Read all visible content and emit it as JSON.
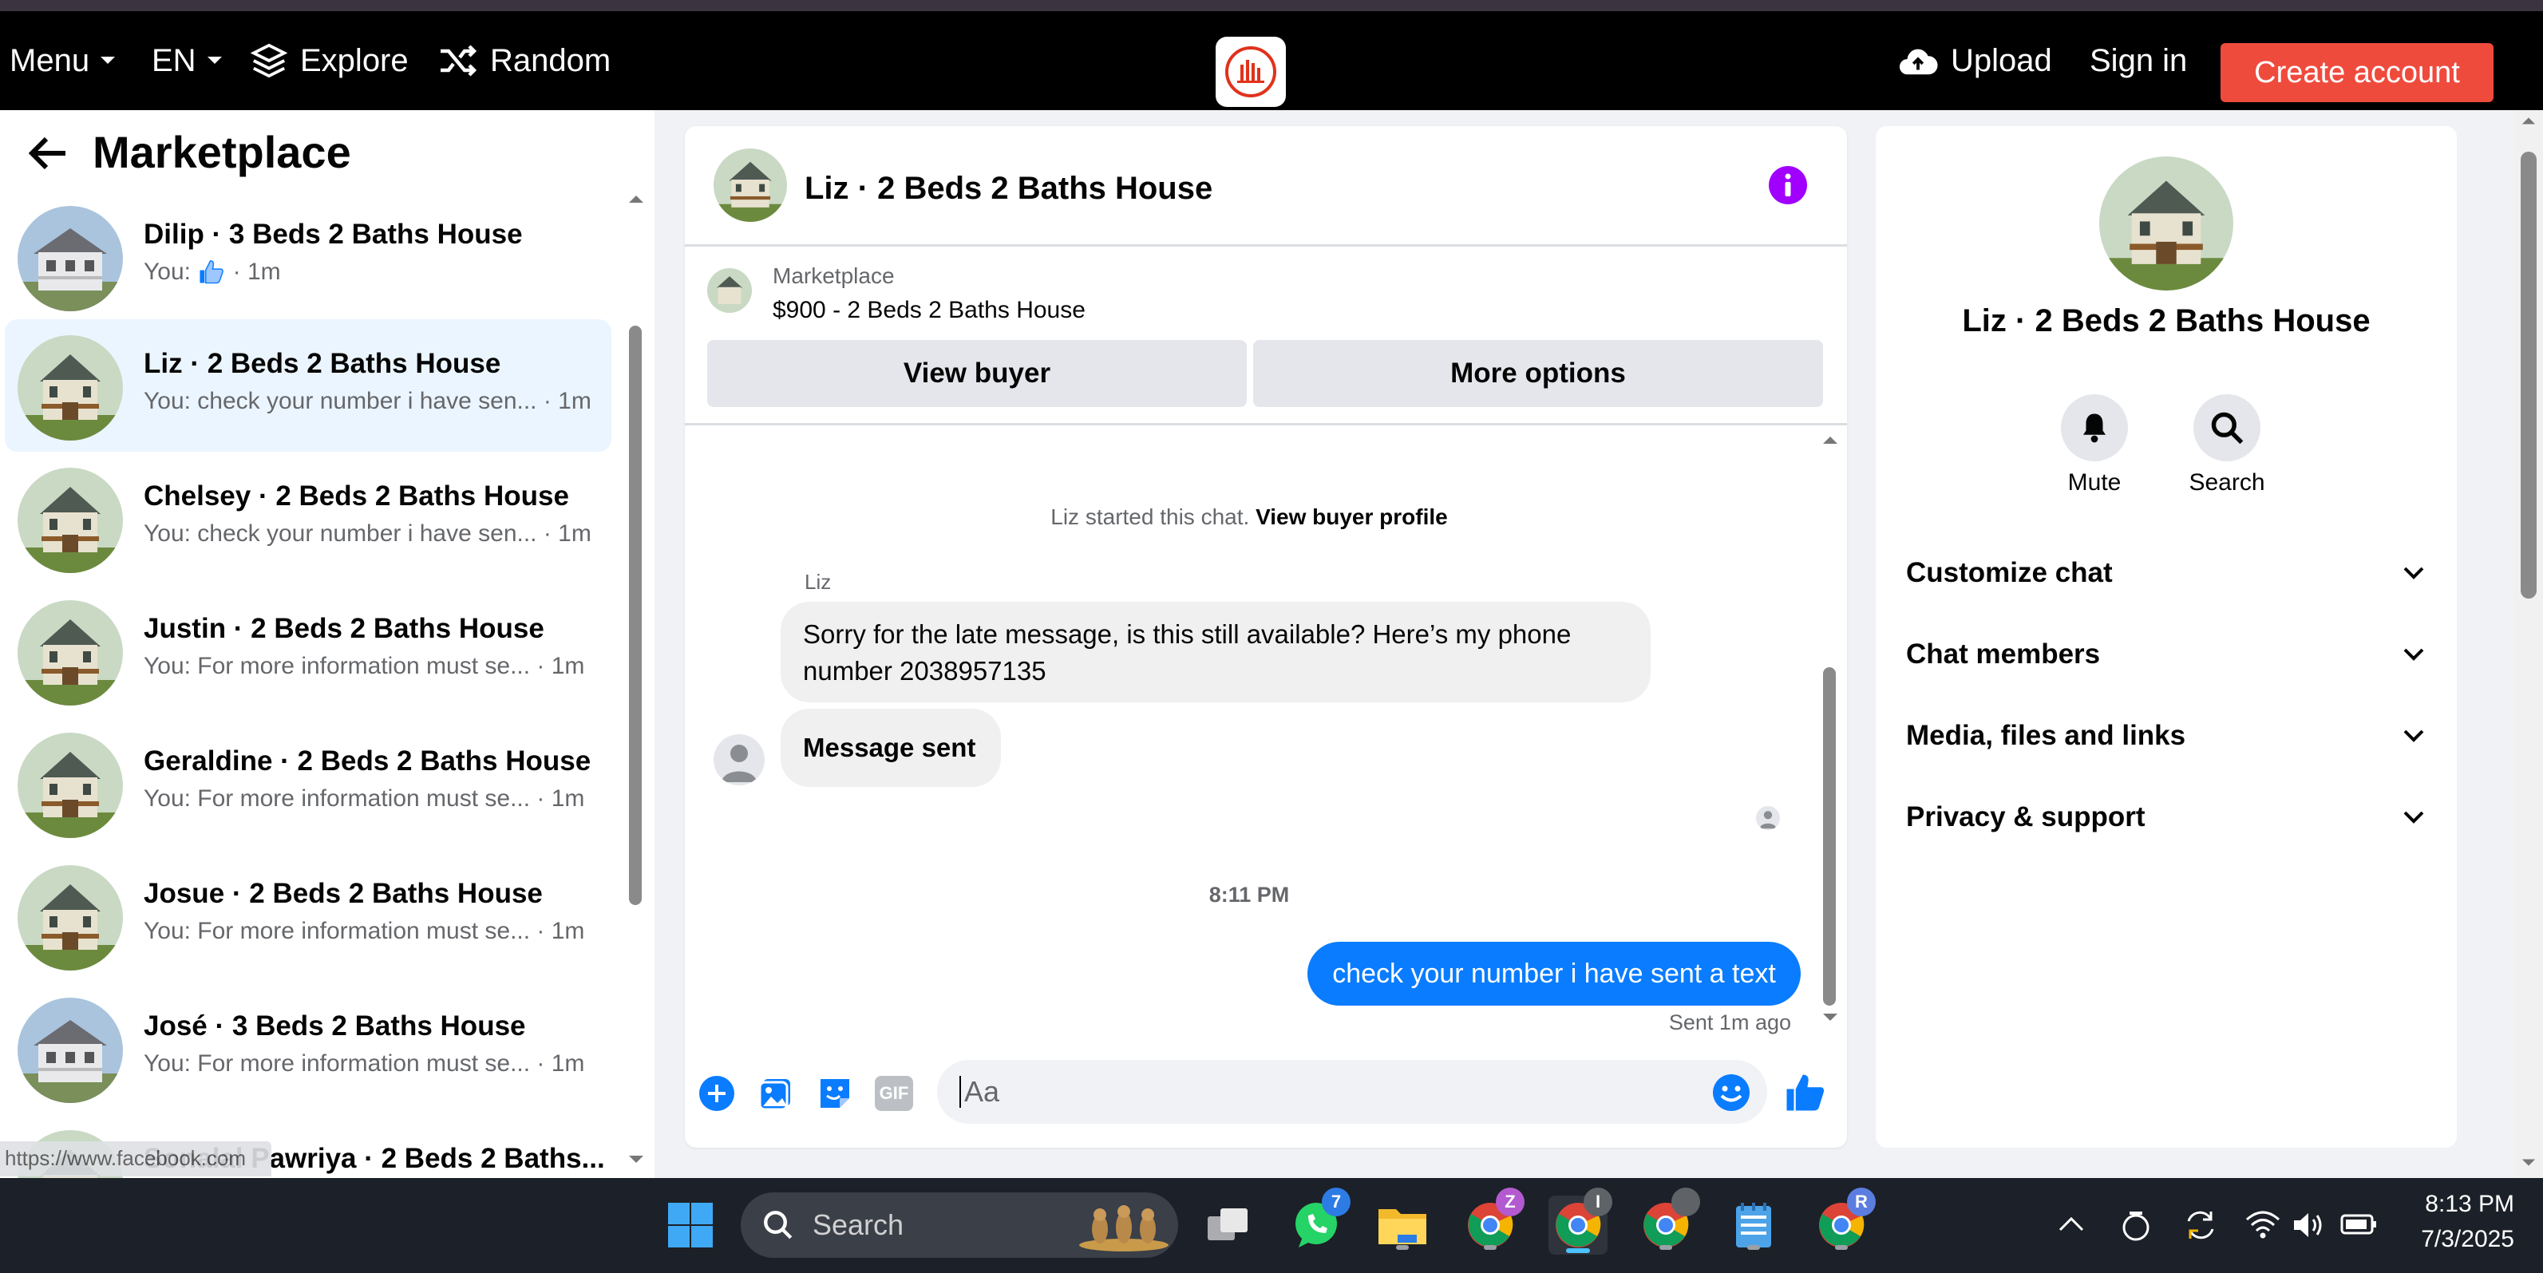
{
  "nav": {
    "menu_label": "Menu",
    "lang_label": "EN",
    "explore_label": "Explore",
    "random_label": "Random",
    "upload_label": "Upload",
    "signin_label": "Sign in",
    "create_label": "Create account"
  },
  "sidebar": {
    "title": "Marketplace",
    "conversations": [
      {
        "name": "Dilip · 3 Beds 2 Baths House",
        "snippet_prefix": "You:",
        "snippet_suffix": "· 1m"
      },
      {
        "name": "Liz · 2 Beds 2 Baths House",
        "snippet": "You: check your number i have sen... · 1m"
      },
      {
        "name": "Chelsey · 2 Beds 2 Baths House",
        "snippet": "You: check your number i have sen... · 1m"
      },
      {
        "name": "Justin · 2 Beds 2 Baths House",
        "snippet": "You: For more information must se... · 1m"
      },
      {
        "name": "Geraldine · 2 Beds 2 Baths House",
        "snippet": "You: For more information must se... · 1m"
      },
      {
        "name": "Josue · 2 Beds 2 Baths House",
        "snippet": "You: For more information must se... · 1m"
      },
      {
        "name": "José · 3 Beds 2 Baths House",
        "snippet": "You: For more information must se... · 1m"
      },
      {
        "name": "Sonalal Pawriya · 2 Beds 2 Baths..."
      }
    ],
    "status_url": "https://www.facebook.com"
  },
  "chat": {
    "title": "Liz · 2 Beds 2 Baths House",
    "listing_label": "Marketplace",
    "listing_detail": "$900 - 2 Beds 2 Baths House",
    "view_buyer": "View buyer",
    "more_options": "More options",
    "started_prefix": "Liz started this chat.",
    "started_link": "View buyer profile",
    "sender_name": "Liz",
    "message_in_line1": "Sorry for the late message, is this still available? Here’s my phone",
    "message_in_line2": "number 2038957135",
    "message_sent_bubble": "Message sent",
    "timestamp": "8:11 PM",
    "message_out": "check your number i have sent a text",
    "sent_status": "Sent 1m ago",
    "composer_placeholder": "Aa",
    "gif_label": "GIF"
  },
  "info": {
    "title": "Liz · 2 Beds 2 Baths House",
    "mute_label": "Mute",
    "search_label": "Search",
    "sections": [
      "Customize chat",
      "Chat members",
      "Media, files and links",
      "Privacy & support"
    ]
  },
  "taskbar": {
    "search_label": "Search",
    "whatsapp_badge": "7",
    "chrome_badges": [
      "Z",
      "I",
      "R"
    ],
    "time": "8:13 PM",
    "date": "7/3/2025"
  },
  "colors": {
    "brand_red": "#ef4b3d",
    "messenger_blue": "#0a7cff",
    "info_purple": "#a100ff",
    "active_row": "#ebf5ff"
  },
  "icons": [
    "chevron-down-icon",
    "layers-icon",
    "shuffle-icon",
    "cloud-upload-icon",
    "back-arrow-icon",
    "like-icon",
    "info-icon",
    "bell-icon",
    "search-icon",
    "plus-icon",
    "image-icon",
    "sticker-icon",
    "gif-icon",
    "emoji-icon",
    "thumbs-up-icon",
    "windows-icon"
  ]
}
